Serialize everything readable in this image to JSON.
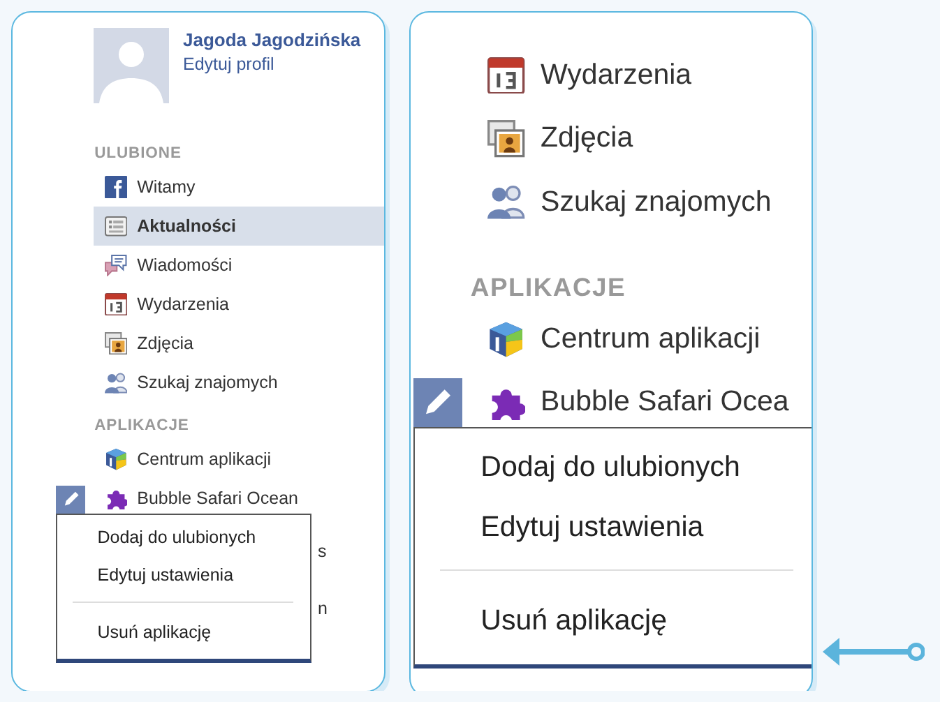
{
  "sidebar": {
    "profile": {
      "name": "Jagoda Jagodzińska",
      "edit_link": "Edytuj profil"
    },
    "sections": [
      {
        "title": "ULUBIONE",
        "items": [
          {
            "label": "Witamy",
            "kind": "facebook",
            "selected": false,
            "edit_button": false
          },
          {
            "label": "Aktualności",
            "kind": "news",
            "selected": true,
            "edit_button": false
          },
          {
            "label": "Wiadomości",
            "kind": "messages",
            "selected": false,
            "edit_button": false
          },
          {
            "label": "Wydarzenia",
            "kind": "calendar",
            "selected": false,
            "edit_button": false
          },
          {
            "label": "Zdjęcia",
            "kind": "photos",
            "selected": false,
            "edit_button": false
          },
          {
            "label": "Szukaj znajomych",
            "kind": "friends",
            "selected": false,
            "edit_button": false
          }
        ]
      },
      {
        "title": "APLIKACJE",
        "items": [
          {
            "label": "Centrum aplikacji",
            "kind": "appcenter",
            "selected": false,
            "edit_button": false
          },
          {
            "label": "Bubble Safari Ocean",
            "kind": "puzzle",
            "selected": false,
            "edit_button": true
          }
        ]
      }
    ],
    "context_menu": [
      {
        "kind": "item",
        "label": "Dodaj do ulubionych"
      },
      {
        "kind": "item",
        "label": "Edytuj ustawienia"
      },
      {
        "kind": "divider"
      },
      {
        "kind": "item",
        "label": "Usuń aplikację"
      }
    ],
    "covered_fragments": [
      "s",
      "n"
    ]
  },
  "zoom_view": {
    "sections": [
      {
        "items": [
          {
            "label": "Wydarzenia",
            "kind": "calendar",
            "selected": false,
            "edit_button": false
          },
          {
            "label": "Zdjęcia",
            "kind": "photos",
            "selected": false,
            "edit_button": false
          },
          {
            "label": "Szukaj znajomych",
            "kind": "friends",
            "selected": false,
            "edit_button": false
          }
        ]
      },
      {
        "title": "APLIKACJE",
        "items": [
          {
            "label": "Centrum aplikacji",
            "kind": "appcenter",
            "selected": false,
            "edit_button": false
          },
          {
            "label": "Bubble Safari Ocea",
            "kind": "puzzle",
            "selected": false,
            "edit_button": true
          }
        ]
      }
    ],
    "context_menu": [
      {
        "kind": "item",
        "label": "Dodaj do ulubionych"
      },
      {
        "kind": "item",
        "label": "Edytuj ustawienia"
      },
      {
        "kind": "divider"
      },
      {
        "kind": "item",
        "label": "Usuń aplikację"
      }
    ]
  }
}
